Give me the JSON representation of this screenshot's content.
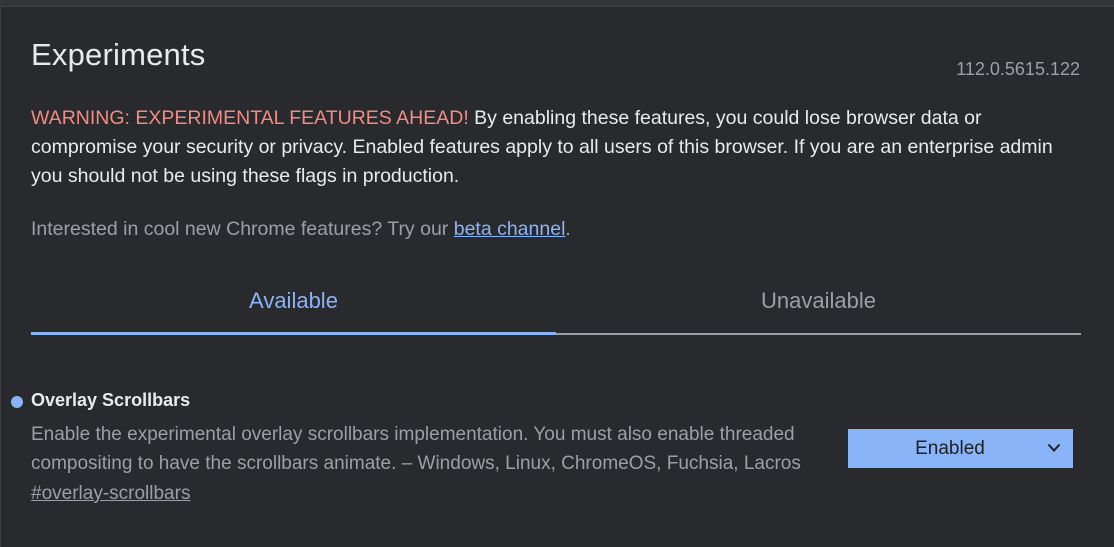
{
  "header": {
    "title": "Experiments",
    "version": "112.0.5615.122"
  },
  "warning": {
    "lead": "WARNING: EXPERIMENTAL FEATURES AHEAD!",
    "body": " By enabling these features, you could lose browser data or compromise your security or privacy. Enabled features apply to all users of this browser. If you are an enterprise admin you should not be using these flags in production."
  },
  "beta": {
    "prefix": "Interested in cool new Chrome features? Try our ",
    "link": "beta channel",
    "suffix": "."
  },
  "tabs": [
    {
      "label": "Available",
      "active": true
    },
    {
      "label": "Unavailable",
      "active": false
    }
  ],
  "flag": {
    "name": "Overlay Scrollbars",
    "description": "Enable the experimental overlay scrollbars implementation. You must also enable threaded compositing to have the scrollbars animate. – Windows, Linux, ChromeOS, Fuchsia, Lacros",
    "anchor": "#overlay-scrollbars",
    "selected_option": "Enabled",
    "dot_icon": "modified-indicator-dot"
  },
  "colors": {
    "background": "#292a2d",
    "accent": "#8ab4f8",
    "warning": "#f28b82",
    "text": "#e8eaed",
    "muted": "#9aa0a6"
  }
}
